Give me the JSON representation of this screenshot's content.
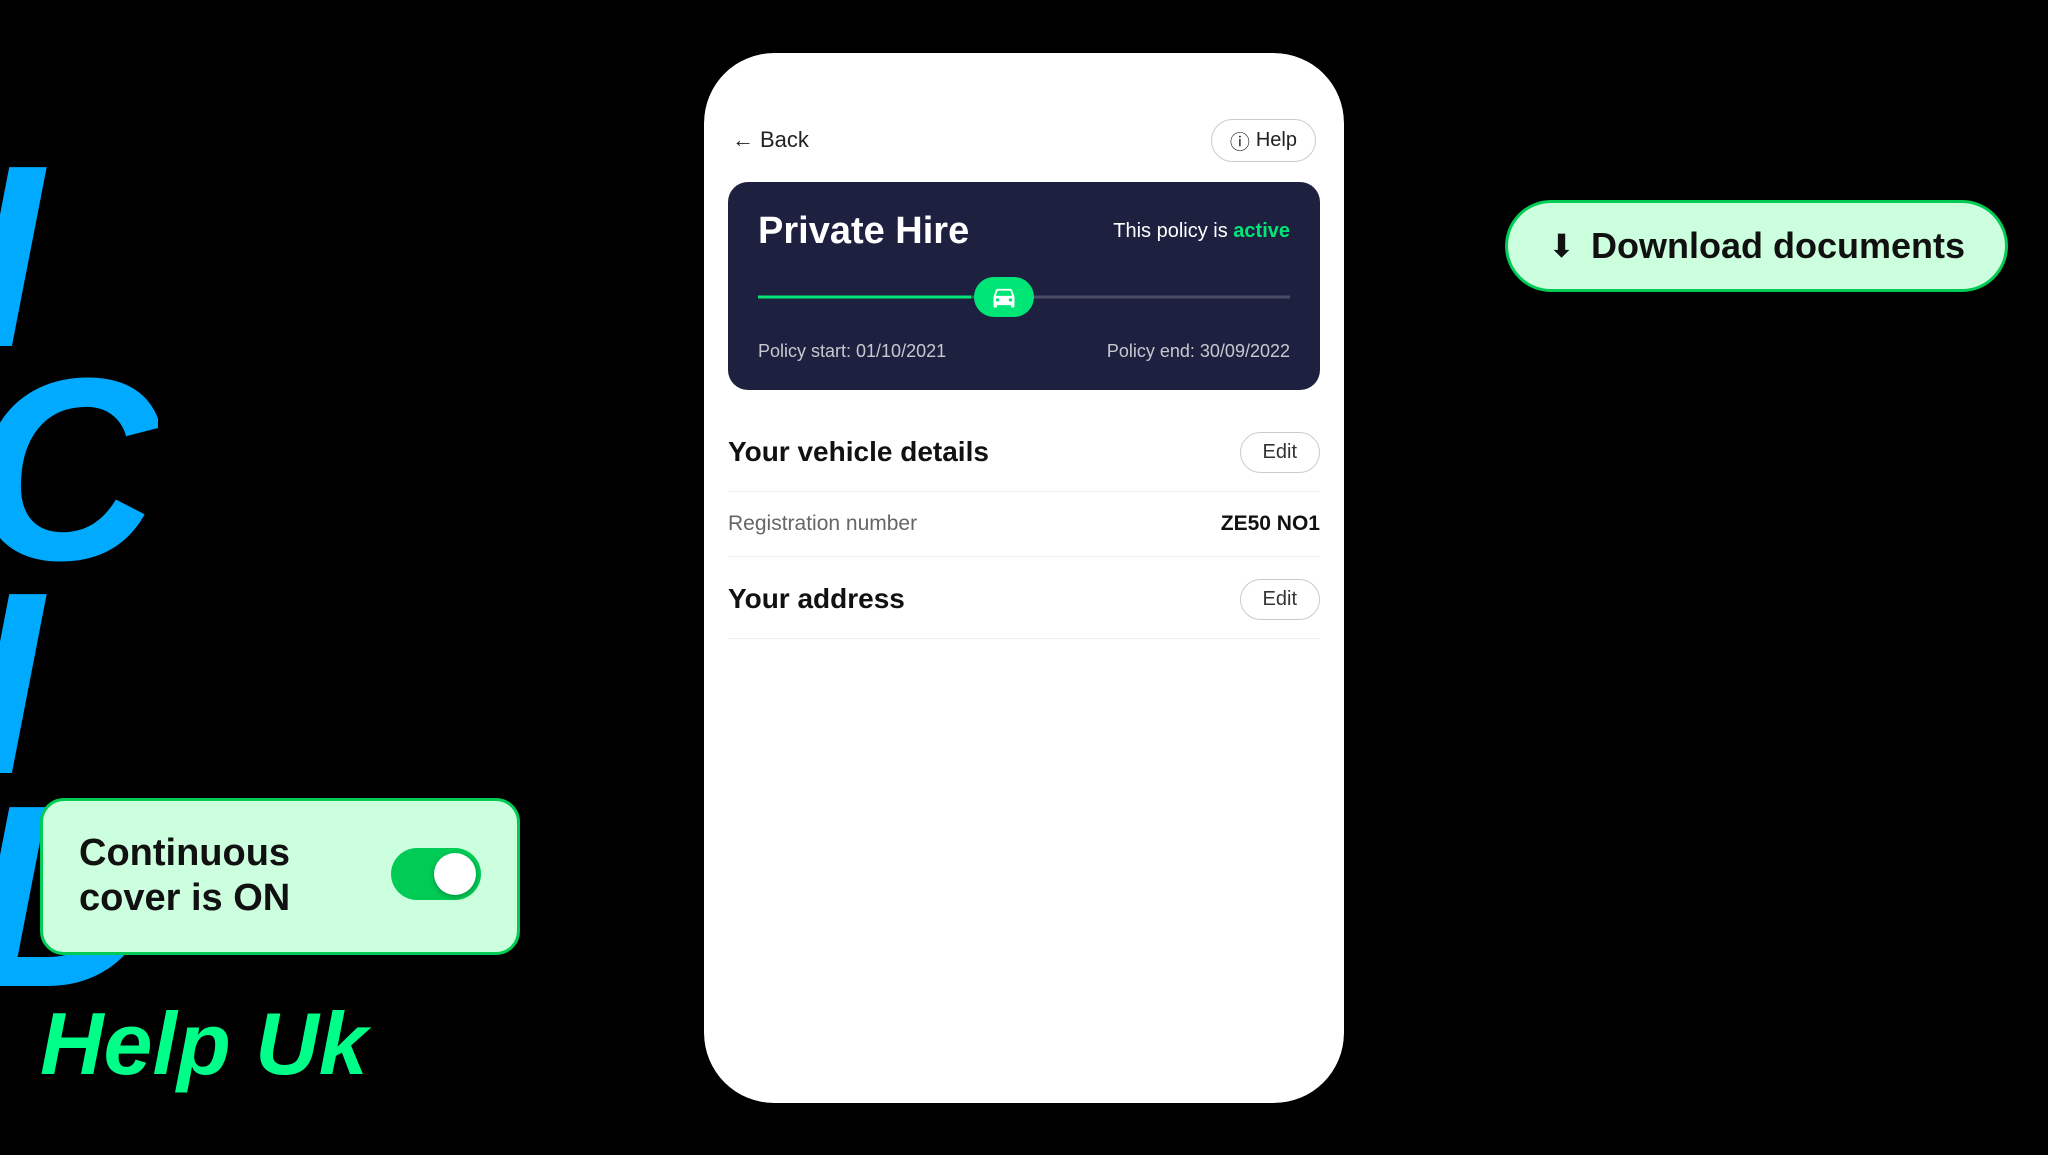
{
  "brand": {
    "letters": [
      "I",
      "C",
      "I",
      "D"
    ],
    "help_text": "Help Uk"
  },
  "header": {
    "back_label": "Back",
    "help_label": "Help"
  },
  "policy_card": {
    "title": "Private Hire",
    "status_prefix": "This policy is",
    "status": "active",
    "timeline_position": "40%",
    "start_label": "Policy start: 01/10/2021",
    "end_label": "Policy end: 30/09/2022"
  },
  "vehicle_section": {
    "title": "Your vehicle details",
    "edit_label": "Edit",
    "rows": [
      {
        "label": "Registration number",
        "value": "ZE50 NO1"
      }
    ]
  },
  "address_section": {
    "title": "Your address",
    "edit_label": "Edit"
  },
  "download_callout": {
    "icon": "⬇",
    "label": "Download documents"
  },
  "cover_callout": {
    "text": "Continuous cover is ON",
    "toggle_on": true
  }
}
